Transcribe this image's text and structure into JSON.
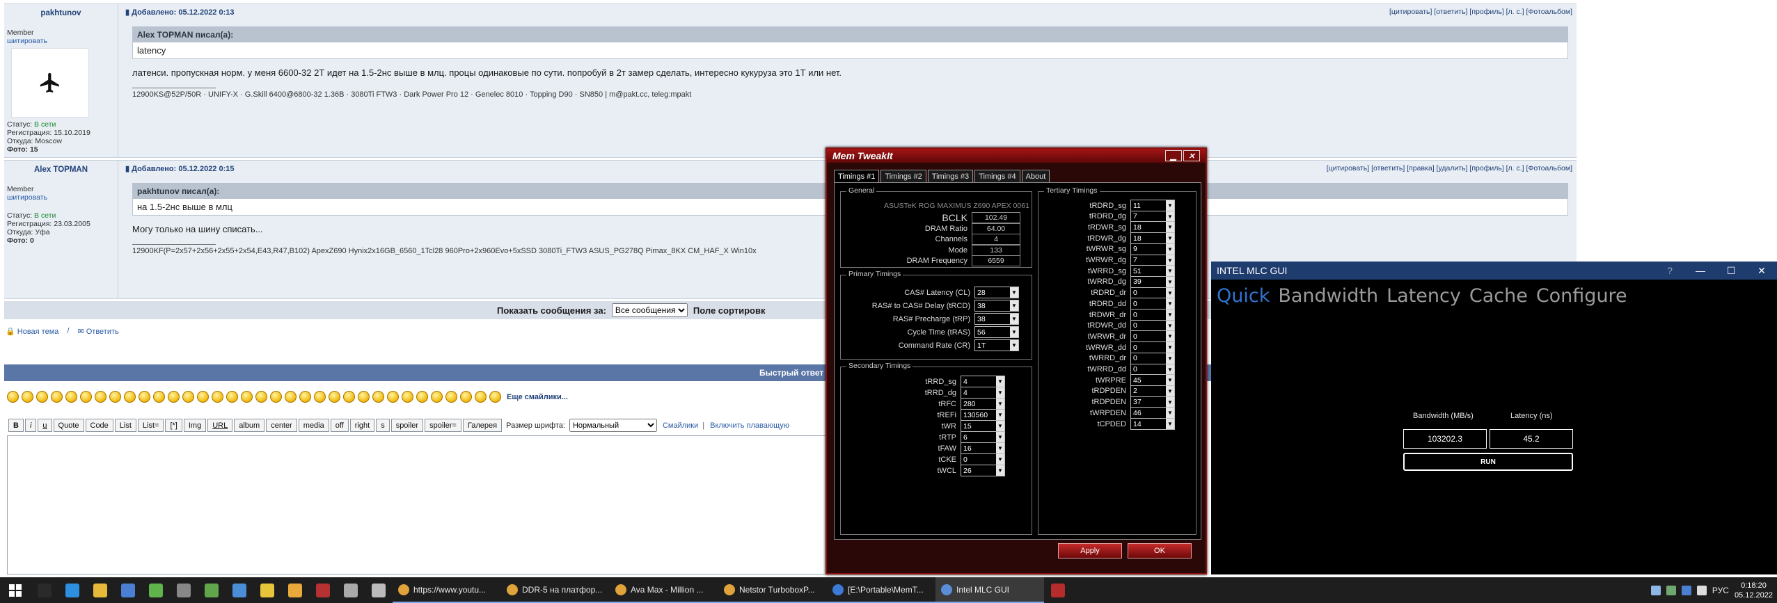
{
  "posts": [
    {
      "username": "pakhtunov",
      "rank": "Member",
      "quote_link": "шитировать",
      "status_label": "Статус:",
      "status_value": "В сети",
      "reg_label": "Регистрация:",
      "reg_value": "15.10.2019",
      "from_label": "Откуда:",
      "from_value": "Moscow",
      "photo_label": "Фото:",
      "photo_value": "15",
      "date": "Добавлено: 05.12.2022 0:13",
      "actions": "[цитировать] [ответить] [профиль] [л. с.] [Фотоальбом]",
      "quote_author": "Alex TOPMAN писал(а):",
      "quote_text": "latency",
      "message": "латенси. пропускная норм. у меня 6600-32 2Т идет на 1.5-2нс выше в млц. процы одинаковые по сути. попробуй в 2т замер сделать, интересно кукуруза это 1Т или нет.",
      "signature": "12900KS@52P/50R · UNIFY-X · G.Skill 6400@6800-32 1.36В · 3080Ti FTW3 · Dark Power Pro 12 · Genelec 8010 · Topping D90 · SN850 | m@pakt.cc, teleg:mpakt"
    },
    {
      "username": "Alex TOPMAN",
      "rank": "Member",
      "quote_link": "шитировать",
      "status_label": "Статус:",
      "status_value": "В сети",
      "reg_label": "Регистрация:",
      "reg_value": "23.03.2005",
      "from_label": "Откуда:",
      "from_value": "Уфа",
      "photo_label": "Фото:",
      "photo_value": "0",
      "date": "Добавлено: 05.12.2022 0:15",
      "actions": "[цитировать] [ответить] [правка] [удалить] [профиль] [л. с.] [Фотоальбом]",
      "quote_author": "pakhtunov писал(а):",
      "quote_text": "на 1.5-2нс выше в млц",
      "message": "Могу только на шину списать...",
      "signature": "12900KF(P=2x57+2x56+2x55+2x54,E43,R47,B102) ApexZ690 Hynix2x16GB_6560_1Tcl28 960Pro+2x960Evo+5xSSD 3080Ti_FTW3 ASUS_PG278Q Pimax_8KX CM_HAF_X Win10x"
    }
  ],
  "show_bar": {
    "label": "Показать сообщения за:",
    "select_value": "Все сообщения",
    "sort_label": "Поле сортировк"
  },
  "new_topic": "Новая тема",
  "reply": "Ответить",
  "quick_reply": "Быстрый ответ",
  "more_smileys": "Еще смайлики...",
  "editor_buttons": [
    "B",
    "i",
    "u",
    "Quote",
    "Code",
    "List",
    "List=",
    "[*]",
    "Img",
    "URL",
    "album",
    "center",
    "media",
    "off",
    "right",
    "s",
    "spoiler",
    "spoiler=",
    "Галерея"
  ],
  "font_size_label": "Размер шрифта:",
  "font_size_value": "Нормальный",
  "smileys_link": "Смайлики",
  "floating_link": "Включить плавающую",
  "memtweakit": {
    "title": "Mem TweakIt",
    "tabs": [
      "Timings #1",
      "Timings #2",
      "Timings #3",
      "Timings #4",
      "About"
    ],
    "general": {
      "title": "General",
      "board": "ASUSTeK ROG MAXIMUS Z690 APEX 0061",
      "rows": [
        {
          "label": "BCLK",
          "value": "102.49"
        },
        {
          "label": "DRAM Ratio",
          "value": "64.00"
        },
        {
          "label": "Channels",
          "value": "4"
        },
        {
          "label": "Mode",
          "value": "133"
        },
        {
          "label": "DRAM Frequency",
          "value": "6559"
        }
      ]
    },
    "primary": {
      "title": "Primary Timings",
      "rows": [
        {
          "label": "CAS# Latency (CL)",
          "value": "28"
        },
        {
          "label": "RAS# to CAS# Delay (tRCD)",
          "value": "38"
        },
        {
          "label": "RAS# Precharge (tRP)",
          "value": "38"
        },
        {
          "label": "Cycle Time (tRAS)",
          "value": "56"
        },
        {
          "label": "Command Rate (CR)",
          "value": "1T"
        }
      ]
    },
    "secondary": {
      "title": "Secondary Timings",
      "rows": [
        {
          "label": "tRRD_sg",
          "value": "4"
        },
        {
          "label": "tRRD_dg",
          "value": "4"
        },
        {
          "label": "tRFC",
          "value": "280"
        },
        {
          "label": "tREFi",
          "value": "130560"
        },
        {
          "label": "tWR",
          "value": "15"
        },
        {
          "label": "tRTP",
          "value": "6"
        },
        {
          "label": "tFAW",
          "value": "16"
        },
        {
          "label": "tCKE",
          "value": "0"
        },
        {
          "label": "tWCL",
          "value": "26"
        }
      ]
    },
    "tertiary": {
      "title": "Tertiary Timings",
      "rows": [
        {
          "label": "tRDRD_sg",
          "value": "11"
        },
        {
          "label": "tRDRD_dg",
          "value": "7"
        },
        {
          "label": "tRDWR_sg",
          "value": "18"
        },
        {
          "label": "tRDWR_dg",
          "value": "18"
        },
        {
          "label": "tWRWR_sg",
          "value": "9"
        },
        {
          "label": "tWRWR_dg",
          "value": "7"
        },
        {
          "label": "tWRRD_sg",
          "value": "51"
        },
        {
          "label": "tWRRD_dg",
          "value": "39"
        },
        {
          "label": "tRDRD_dr",
          "value": "0"
        },
        {
          "label": "tRDRD_dd",
          "value": "0"
        },
        {
          "label": "tRDWR_dr",
          "value": "0"
        },
        {
          "label": "tRDWR_dd",
          "value": "0"
        },
        {
          "label": "tWRWR_dr",
          "value": "0"
        },
        {
          "label": "tWRWR_dd",
          "value": "0"
        },
        {
          "label": "tWRRD_dr",
          "value": "0"
        },
        {
          "label": "tWRRD_dd",
          "value": "0"
        },
        {
          "label": "tWRPRE",
          "value": "45"
        },
        {
          "label": "tRDPDEN",
          "value": "2"
        },
        {
          "label": "tRDPDEN",
          "value": "37"
        },
        {
          "label": "tWRPDEN",
          "value": "46"
        },
        {
          "label": "tCPDED",
          "value": "14"
        }
      ]
    },
    "apply": "Apply",
    "ok": "OK"
  },
  "mlc": {
    "title": "INTEL MLC GUI",
    "help": "?",
    "tabs": [
      "Quick",
      "Bandwidth",
      "Latency",
      "Cache",
      "Configure"
    ],
    "bandwidth_label": "Bandwidth (MB/s)",
    "latency_label": "Latency (ns)",
    "bandwidth_value": "103202.3",
    "latency_value": "45.2",
    "run": "RUN"
  },
  "taskbar": {
    "apps": [
      {
        "label": "https://www.youtu...",
        "color": "#e0a23a"
      },
      {
        "label": "DDR-5 на платфор...",
        "color": "#e0a23a"
      },
      {
        "label": "Ava Max - Million ...",
        "color": "#e0a23a"
      },
      {
        "label": "Netstor TurboboxP...",
        "color": "#e0a23a"
      },
      {
        "label": "[E:\\Portable\\MemT...",
        "color": "#3b7bd6"
      },
      {
        "label": "Intel MLC GUI",
        "color": "#5a8fd8"
      }
    ],
    "lang": "РУС",
    "time": "0:18:20",
    "date": "05.12.2022"
  }
}
